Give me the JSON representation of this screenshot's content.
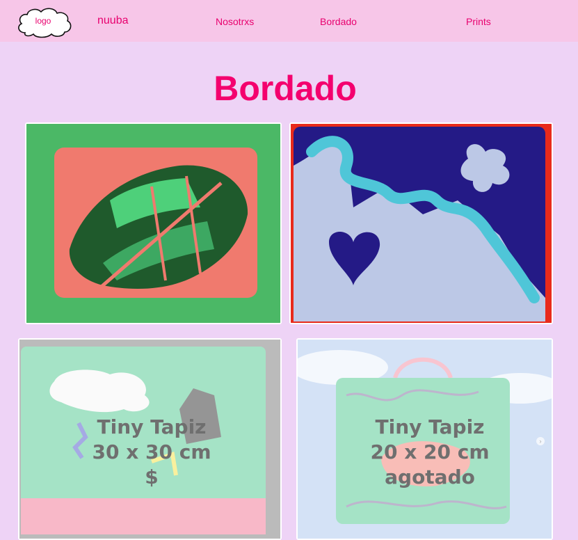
{
  "nav": {
    "logo": "logo",
    "brand": "nuuba",
    "links": [
      "Nosotrxs",
      "Bordado",
      "Prints"
    ]
  },
  "page": {
    "title": "Bordado"
  },
  "products": [
    {
      "lines": [
        "Tiny Tapiz",
        "30 x 30 cm",
        "$"
      ]
    },
    {
      "lines": [
        "Tiny Tapiz",
        "20 x 20 cm",
        "agotado"
      ]
    }
  ],
  "colors": {
    "accent": "#f4006e",
    "nav_bg": "#f7c6e8",
    "page_bg": "#eed3f6"
  },
  "icons": {
    "carousel_next": "chevron-right-icon"
  }
}
